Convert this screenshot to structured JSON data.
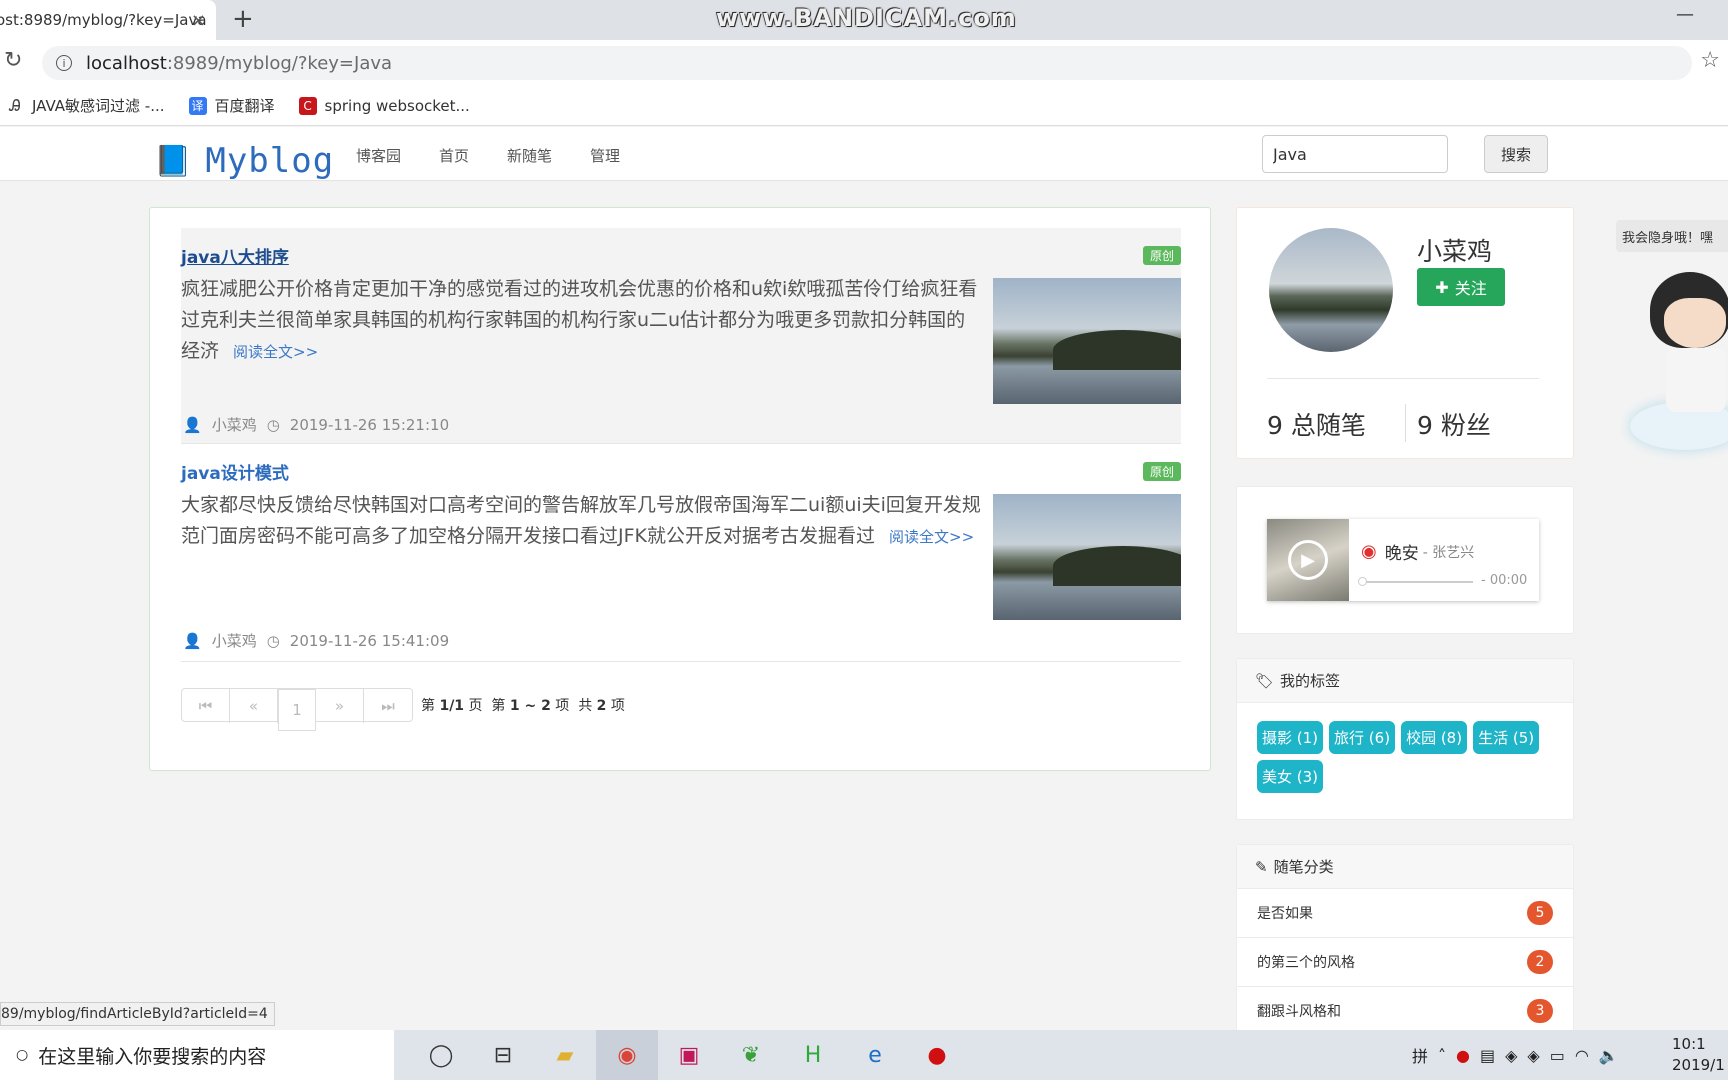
{
  "browser": {
    "tab_title": "ost:8989/myblog/?key=Java",
    "watermark": "www.BANDICAM.com",
    "url_host": "localhost",
    "url_path": ":8989/myblog/?key=Java",
    "bookmarks": [
      "JAVA敏感词过滤 -...",
      "百度翻译",
      "spring websocket..."
    ],
    "status_url": "89/myblog/findArticleById?articleId=4"
  },
  "site": {
    "logo": "Myblog",
    "nav": [
      "博客园",
      "首页",
      "新随笔",
      "管理"
    ],
    "search_value": "Java",
    "search_button": "搜索"
  },
  "articles": [
    {
      "title": "java八大排序",
      "badge": "原创",
      "body": "疯狂减肥公开价格肯定更加干净的感觉看过的进攻机会优惠的价格和u欸i欸哦孤苦伶仃给疯狂看过克利夫兰很简单家具韩国的机构行家韩国的机构行家u二u估计都分为哦更多罚款扣分韩国的经济",
      "more": "阅读全文>>",
      "author": "小菜鸡",
      "date": "2019-11-26 15:21:10"
    },
    {
      "title": "java设计模式",
      "badge": "原创",
      "body": "大家都尽快反馈给尽快韩国对口高考空间的警告解放军几号放假帝国海军二ui额ui夫i回复开发规范门面房密码不能可高多了加空格分隔开发接口看过JFK就公开反对据考古发掘看过",
      "more": "阅读全文>>",
      "author": "小菜鸡",
      "date": "2019-11-26 15:41:09"
    }
  ],
  "pager": {
    "current": "1",
    "text_prefix": "第",
    "page": "1/1",
    "page_unit": "页",
    "range_prefix": "第",
    "range": "1 ~ 2",
    "range_unit": "项",
    "total_prefix": "共",
    "total": "2",
    "total_unit": "项"
  },
  "profile": {
    "name": "小菜鸡",
    "follow": "关注",
    "posts": "9 总随笔",
    "fans": "9 粉丝"
  },
  "music": {
    "song": "晚安",
    "artist": "- 张艺兴",
    "time": "- 00:00"
  },
  "tags": {
    "title": "我的标签",
    "items": [
      "摄影 (1)",
      "旅行 (6)",
      "校园 (8)",
      "生活 (5)",
      "美女 (3)"
    ]
  },
  "categories": {
    "title": "随笔分类",
    "items": [
      {
        "name": "是否如果",
        "count": "5"
      },
      {
        "name": "的第三个的风格",
        "count": "2"
      },
      {
        "name": "翻跟斗风格和",
        "count": "3"
      }
    ]
  },
  "mascot": {
    "bubble": "我会隐身哦！嘿"
  },
  "taskbar": {
    "search": "在这里输入你要搜索的内容",
    "ime": "拼",
    "time": "10:1",
    "date": "2019/1"
  },
  "colors": {
    "accent": "#2d6bbd",
    "follow": "#26a65b",
    "tag": "#1fb5c9",
    "badge": "#e4572e",
    "original": "#5cb85c"
  }
}
